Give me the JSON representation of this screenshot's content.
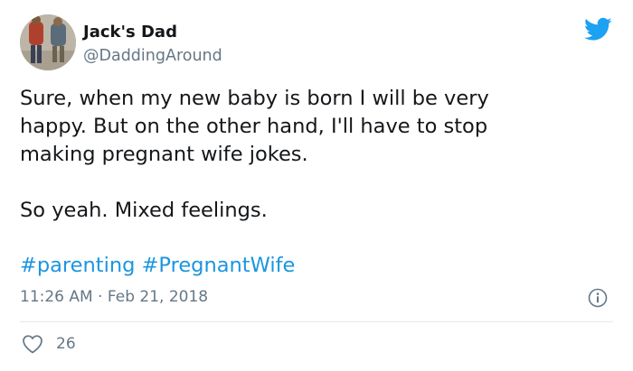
{
  "tweet": {
    "display_name": "Jack's Dad",
    "handle": "@DaddingAround",
    "body_lines": [
      "Sure, when my new baby is born I will be very",
      "happy. But on the other hand, I'll have to stop",
      "making pregnant wife jokes.",
      "So yeah. Mixed feelings."
    ],
    "hashtags": [
      "#parenting",
      "#PregnantWife"
    ],
    "time": "11:26 AM",
    "separator": "·",
    "date": "Feb 21, 2018",
    "like_count": "26"
  },
  "icons": {
    "brand": "twitter-bird-icon",
    "info": "info-icon",
    "like": "heart-icon"
  },
  "colors": {
    "brand_blue": "#1da1f2",
    "hashtag_blue": "#1b95e0",
    "text": "#14171a",
    "secondary": "#657786",
    "divider": "#e1e8ed"
  }
}
